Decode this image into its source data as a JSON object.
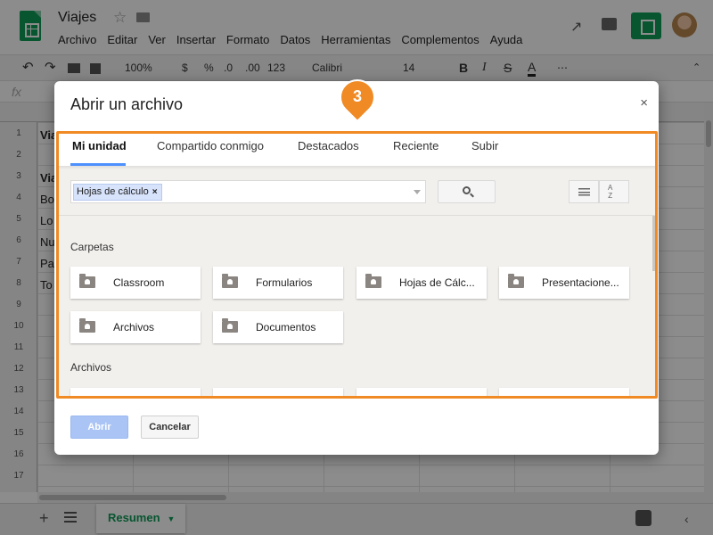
{
  "app": {
    "doc_title": "Viajes",
    "menu": [
      "Archivo",
      "Editar",
      "Ver",
      "Insertar",
      "Formato",
      "Datos",
      "Herramientas",
      "Complementos",
      "Ayuda"
    ]
  },
  "toolbar": {
    "zoom": "100%",
    "currency": "$",
    "percent": "%",
    "decimal_less": ".0",
    "decimal_more": ".00",
    "number_format": "123",
    "font": "Calibri",
    "font_size": "14",
    "bold": "B",
    "italic": "I",
    "strike": "S",
    "text_color": "A",
    "more": "⋯"
  },
  "formula_bar": {
    "fx": "fx"
  },
  "grid": {
    "row_numbers": [
      "1",
      "2",
      "3",
      "4",
      "5",
      "6",
      "7",
      "8",
      "9",
      "10",
      "11",
      "12",
      "13",
      "14",
      "15",
      "16",
      "17"
    ],
    "cells": [
      "Via",
      "Viaj",
      "Bo",
      "Lo",
      "Nu",
      "Pa",
      "To"
    ]
  },
  "sheets": {
    "active_tab": "Resumen"
  },
  "dialog": {
    "title": "Abrir un archivo",
    "close": "×",
    "tabs": [
      "Mi unidad",
      "Compartido conmigo",
      "Destacados",
      "Reciente",
      "Subir"
    ],
    "active_tab": "Mi unidad",
    "filter_chip": "Hojas de cálculo",
    "chip_remove": "×",
    "folders_label": "Carpetas",
    "folders": [
      "Classroom",
      "Formularios",
      "Hojas de Cálc...",
      "Presentacione...",
      "Archivos",
      "Documentos"
    ],
    "files_label": "Archivos",
    "open_button": "Abrir",
    "cancel_button": "Cancelar"
  },
  "callout": {
    "step": "3"
  },
  "colors": {
    "accent_orange": "#f08a24",
    "sheets_green": "#0f9d58",
    "tab_underline": "#4d90fe",
    "open_button_disabled": "#a9c4f5"
  },
  "icons": [
    "sheets-logo-icon",
    "star-icon",
    "folder-icon",
    "trend-icon",
    "comment-icon",
    "share-icon",
    "search-icon",
    "list-view-icon",
    "sort-az-icon",
    "close-icon",
    "add-sheet-icon",
    "sheet-list-icon",
    "explore-icon",
    "collapse-icon"
  ]
}
